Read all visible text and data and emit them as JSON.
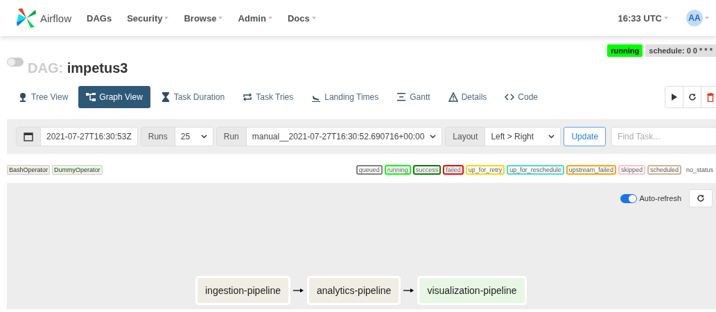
{
  "brand": "Airflow",
  "nav": [
    {
      "label": "DAGs",
      "dropdown": false
    },
    {
      "label": "Security",
      "dropdown": true
    },
    {
      "label": "Browse",
      "dropdown": true
    },
    {
      "label": "Admin",
      "dropdown": true
    },
    {
      "label": "Docs",
      "dropdown": true
    }
  ],
  "clock": "16:33 UTC",
  "avatar": "AA",
  "dag": {
    "prefix": "DAG:",
    "name": "impetus3",
    "enabled": false,
    "status": "running",
    "schedule": "schedule: 0 0 * * *"
  },
  "tabs": [
    {
      "label": "Tree View",
      "selected": false
    },
    {
      "label": "Graph View",
      "selected": true
    },
    {
      "label": "Task Duration",
      "selected": false
    },
    {
      "label": "Task Tries",
      "selected": false
    },
    {
      "label": "Landing Times",
      "selected": false
    },
    {
      "label": "Gantt",
      "selected": false
    },
    {
      "label": "Details",
      "selected": false
    },
    {
      "label": "Code",
      "selected": false
    }
  ],
  "filters": {
    "date": "2021-07-27T16:30:53Z",
    "runs_label": "Runs",
    "runs": "25",
    "run_label": "Run",
    "run": "manual__2021-07-27T16:30:52.690716+00:00",
    "layout_label": "Layout",
    "layout": "Left > Right",
    "update": "Update",
    "search_placeholder": "Find Task..."
  },
  "operators": [
    {
      "label": "BashOperator",
      "color": "#f0ede4"
    },
    {
      "label": "DummyOperator",
      "color": "#e8f7e4"
    }
  ],
  "states": [
    {
      "label": "queued",
      "color": "#808080"
    },
    {
      "label": "running",
      "color": "#00ff00"
    },
    {
      "label": "success",
      "color": "#008000"
    },
    {
      "label": "failed",
      "color": "#ff0000"
    },
    {
      "label": "up_for_retry",
      "color": "#ffd700"
    },
    {
      "label": "up_for_reschedule",
      "color": "#40e0d0"
    },
    {
      "label": "upstream_failed",
      "color": "#ffa500"
    },
    {
      "label": "skipped",
      "color": "#ffc0cb"
    },
    {
      "label": "scheduled",
      "color": "#d2b48c"
    },
    {
      "label": "no_status",
      "color": "#ffffff"
    }
  ],
  "auto_refresh": {
    "label": "Auto-refresh",
    "on": true
  },
  "nodes": [
    {
      "label": "ingestion-pipeline",
      "color": "#f0ede4"
    },
    {
      "label": "analytics-pipeline",
      "color": "#f0ede4"
    },
    {
      "label": "visualization-pipeline",
      "color": "#e8f7e4"
    }
  ]
}
